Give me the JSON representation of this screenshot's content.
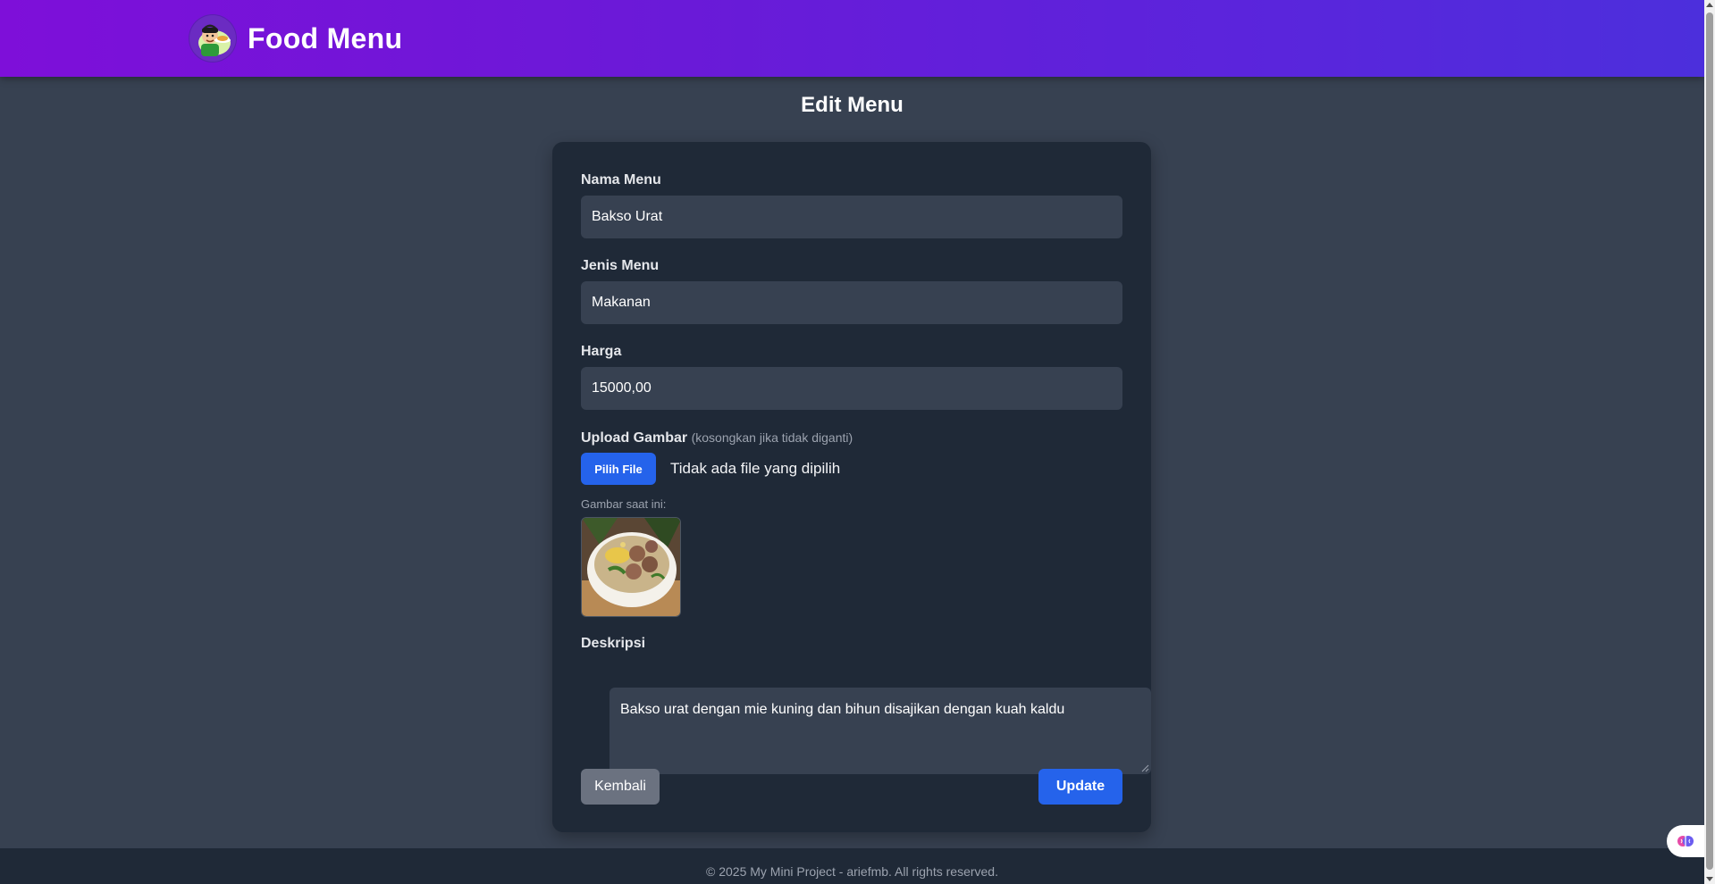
{
  "header": {
    "brand_title": "Food Menu",
    "logo_icon": "chef-mascot-icon",
    "gradient_start": "#7e0fd9",
    "gradient_end": "#4c2fdc"
  },
  "page": {
    "title": "Edit Menu"
  },
  "form": {
    "name_label": "Nama Menu",
    "name_value": "Bakso Urat",
    "type_label": "Jenis Menu",
    "type_value": "Makanan",
    "price_label": "Harga",
    "price_value": "15000,00",
    "upload_label": "Upload Gambar",
    "upload_hint": "(kosongkan jika tidak diganti)",
    "file_button": "Pilih File",
    "file_status": "Tidak ada file yang dipilih",
    "current_image_label": "Gambar saat ini:",
    "current_image_icon": "bakso-bowl-image",
    "description_label": "Deskripsi",
    "description_value": "Bakso urat dengan mie kuning dan bihun disajikan dengan kuah kaldu",
    "back_button": "Kembali",
    "update_button": "Update",
    "accent_color": "#2563eb"
  },
  "footer": {
    "text": "© 2025 My Mini Project - ariefmb. All rights reserved."
  },
  "widget": {
    "icon": "brain-extension-icon"
  }
}
